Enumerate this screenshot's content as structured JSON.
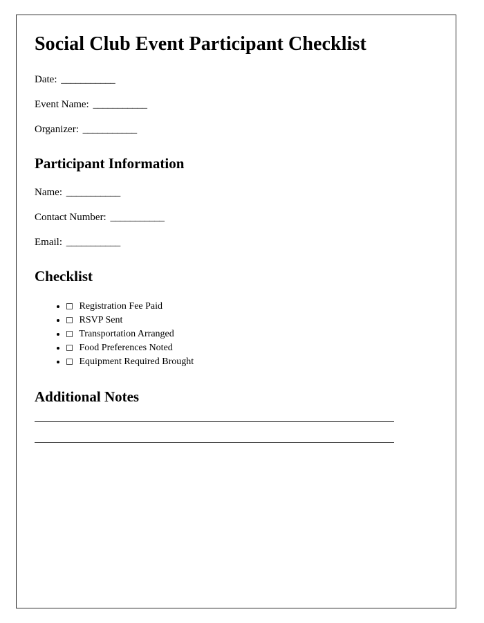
{
  "document": {
    "title": "Social Club Event Participant Checklist",
    "blank_line": "___________"
  },
  "header_fields": [
    {
      "label": "Date:",
      "value": "",
      "blank": "___________"
    },
    {
      "label": "Event Name:",
      "value": "",
      "blank": "___________"
    },
    {
      "label": "Organizer:",
      "value": "",
      "blank": "___________"
    }
  ],
  "participant_section": {
    "heading": "Participant Information",
    "fields": [
      {
        "label": "Name:",
        "value": "",
        "blank": "___________"
      },
      {
        "label": "Contact Number:",
        "value": "",
        "blank": "___________"
      },
      {
        "label": "Email:",
        "value": "",
        "blank": "___________"
      }
    ]
  },
  "checklist_section": {
    "heading": "Checklist",
    "items": [
      {
        "label": "Registration Fee Paid",
        "checked": false
      },
      {
        "label": "RSVP Sent",
        "checked": false
      },
      {
        "label": "Transportation Arranged",
        "checked": false
      },
      {
        "label": "Food Preferences Noted",
        "checked": false
      },
      {
        "label": "Equipment Required Brought",
        "checked": false
      }
    ]
  },
  "notes_section": {
    "heading": "Additional Notes",
    "lines": [
      "",
      ""
    ]
  },
  "colors": {
    "page_border": "#2a2a2a",
    "text": "#000000",
    "rule": "#111111",
    "checkbox_border": "#4a4a4a"
  }
}
